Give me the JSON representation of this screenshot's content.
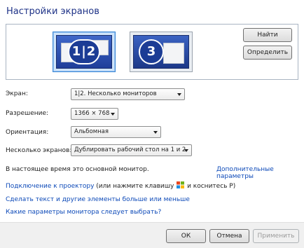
{
  "title": "Настройки экранов",
  "monitors": {
    "selected_label": "1|2",
    "other_label": "3"
  },
  "buttons": {
    "find": "Найти",
    "identify": "Определить",
    "ok": "ОК",
    "cancel": "Отмена",
    "apply": "Применить"
  },
  "fields": {
    "display_label": "Экран:",
    "display_value": "1|2. Несколько мониторов",
    "resolution_label": "Разрешение:",
    "resolution_value": "1366 × 768",
    "orientation_label": "Ориентация:",
    "orientation_value": "Альбомная",
    "multiple_label": "Несколько экранов:",
    "multiple_value": "Дублировать рабочий стол на 1 и 2"
  },
  "status_text": "В настоящее время это основной монитор.",
  "advanced_link": "Дополнительные параметры",
  "projector_link": "Подключение к проектору",
  "projector_hint_1": "(или нажмите клавишу",
  "projector_hint_2": "и коснитесь P)",
  "text_size_link": "Сделать текст и другие элементы больше или меньше",
  "which_settings_link": "Какие параметры монитора следует выбрать?",
  "icons": [
    "windows-logo-icon",
    "chevron-down-icon"
  ]
}
